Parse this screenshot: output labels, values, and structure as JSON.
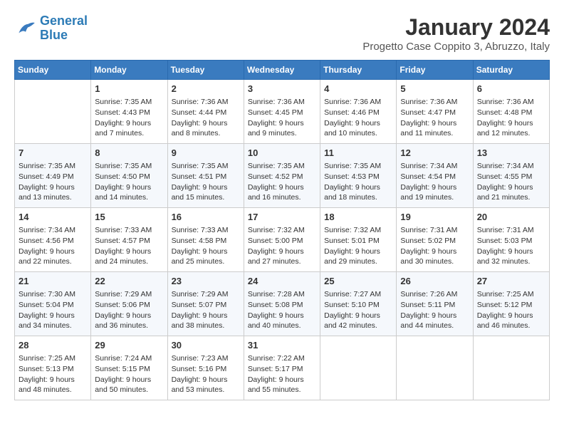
{
  "logo": {
    "line1": "General",
    "line2": "Blue"
  },
  "title": "January 2024",
  "subtitle": "Progetto Case Coppito 3, Abruzzo, Italy",
  "days_of_week": [
    "Sunday",
    "Monday",
    "Tuesday",
    "Wednesday",
    "Thursday",
    "Friday",
    "Saturday"
  ],
  "weeks": [
    [
      {
        "day": "",
        "sunrise": "",
        "sunset": "",
        "daylight": ""
      },
      {
        "day": "1",
        "sunrise": "Sunrise: 7:35 AM",
        "sunset": "Sunset: 4:43 PM",
        "daylight": "Daylight: 9 hours and 7 minutes."
      },
      {
        "day": "2",
        "sunrise": "Sunrise: 7:36 AM",
        "sunset": "Sunset: 4:44 PM",
        "daylight": "Daylight: 9 hours and 8 minutes."
      },
      {
        "day": "3",
        "sunrise": "Sunrise: 7:36 AM",
        "sunset": "Sunset: 4:45 PM",
        "daylight": "Daylight: 9 hours and 9 minutes."
      },
      {
        "day": "4",
        "sunrise": "Sunrise: 7:36 AM",
        "sunset": "Sunset: 4:46 PM",
        "daylight": "Daylight: 9 hours and 10 minutes."
      },
      {
        "day": "5",
        "sunrise": "Sunrise: 7:36 AM",
        "sunset": "Sunset: 4:47 PM",
        "daylight": "Daylight: 9 hours and 11 minutes."
      },
      {
        "day": "6",
        "sunrise": "Sunrise: 7:36 AM",
        "sunset": "Sunset: 4:48 PM",
        "daylight": "Daylight: 9 hours and 12 minutes."
      }
    ],
    [
      {
        "day": "7",
        "sunrise": "Sunrise: 7:35 AM",
        "sunset": "Sunset: 4:49 PM",
        "daylight": "Daylight: 9 hours and 13 minutes."
      },
      {
        "day": "8",
        "sunrise": "Sunrise: 7:35 AM",
        "sunset": "Sunset: 4:50 PM",
        "daylight": "Daylight: 9 hours and 14 minutes."
      },
      {
        "day": "9",
        "sunrise": "Sunrise: 7:35 AM",
        "sunset": "Sunset: 4:51 PM",
        "daylight": "Daylight: 9 hours and 15 minutes."
      },
      {
        "day": "10",
        "sunrise": "Sunrise: 7:35 AM",
        "sunset": "Sunset: 4:52 PM",
        "daylight": "Daylight: 9 hours and 16 minutes."
      },
      {
        "day": "11",
        "sunrise": "Sunrise: 7:35 AM",
        "sunset": "Sunset: 4:53 PM",
        "daylight": "Daylight: 9 hours and 18 minutes."
      },
      {
        "day": "12",
        "sunrise": "Sunrise: 7:34 AM",
        "sunset": "Sunset: 4:54 PM",
        "daylight": "Daylight: 9 hours and 19 minutes."
      },
      {
        "day": "13",
        "sunrise": "Sunrise: 7:34 AM",
        "sunset": "Sunset: 4:55 PM",
        "daylight": "Daylight: 9 hours and 21 minutes."
      }
    ],
    [
      {
        "day": "14",
        "sunrise": "Sunrise: 7:34 AM",
        "sunset": "Sunset: 4:56 PM",
        "daylight": "Daylight: 9 hours and 22 minutes."
      },
      {
        "day": "15",
        "sunrise": "Sunrise: 7:33 AM",
        "sunset": "Sunset: 4:57 PM",
        "daylight": "Daylight: 9 hours and 24 minutes."
      },
      {
        "day": "16",
        "sunrise": "Sunrise: 7:33 AM",
        "sunset": "Sunset: 4:58 PM",
        "daylight": "Daylight: 9 hours and 25 minutes."
      },
      {
        "day": "17",
        "sunrise": "Sunrise: 7:32 AM",
        "sunset": "Sunset: 5:00 PM",
        "daylight": "Daylight: 9 hours and 27 minutes."
      },
      {
        "day": "18",
        "sunrise": "Sunrise: 7:32 AM",
        "sunset": "Sunset: 5:01 PM",
        "daylight": "Daylight: 9 hours and 29 minutes."
      },
      {
        "day": "19",
        "sunrise": "Sunrise: 7:31 AM",
        "sunset": "Sunset: 5:02 PM",
        "daylight": "Daylight: 9 hours and 30 minutes."
      },
      {
        "day": "20",
        "sunrise": "Sunrise: 7:31 AM",
        "sunset": "Sunset: 5:03 PM",
        "daylight": "Daylight: 9 hours and 32 minutes."
      }
    ],
    [
      {
        "day": "21",
        "sunrise": "Sunrise: 7:30 AM",
        "sunset": "Sunset: 5:04 PM",
        "daylight": "Daylight: 9 hours and 34 minutes."
      },
      {
        "day": "22",
        "sunrise": "Sunrise: 7:29 AM",
        "sunset": "Sunset: 5:06 PM",
        "daylight": "Daylight: 9 hours and 36 minutes."
      },
      {
        "day": "23",
        "sunrise": "Sunrise: 7:29 AM",
        "sunset": "Sunset: 5:07 PM",
        "daylight": "Daylight: 9 hours and 38 minutes."
      },
      {
        "day": "24",
        "sunrise": "Sunrise: 7:28 AM",
        "sunset": "Sunset: 5:08 PM",
        "daylight": "Daylight: 9 hours and 40 minutes."
      },
      {
        "day": "25",
        "sunrise": "Sunrise: 7:27 AM",
        "sunset": "Sunset: 5:10 PM",
        "daylight": "Daylight: 9 hours and 42 minutes."
      },
      {
        "day": "26",
        "sunrise": "Sunrise: 7:26 AM",
        "sunset": "Sunset: 5:11 PM",
        "daylight": "Daylight: 9 hours and 44 minutes."
      },
      {
        "day": "27",
        "sunrise": "Sunrise: 7:25 AM",
        "sunset": "Sunset: 5:12 PM",
        "daylight": "Daylight: 9 hours and 46 minutes."
      }
    ],
    [
      {
        "day": "28",
        "sunrise": "Sunrise: 7:25 AM",
        "sunset": "Sunset: 5:13 PM",
        "daylight": "Daylight: 9 hours and 48 minutes."
      },
      {
        "day": "29",
        "sunrise": "Sunrise: 7:24 AM",
        "sunset": "Sunset: 5:15 PM",
        "daylight": "Daylight: 9 hours and 50 minutes."
      },
      {
        "day": "30",
        "sunrise": "Sunrise: 7:23 AM",
        "sunset": "Sunset: 5:16 PM",
        "daylight": "Daylight: 9 hours and 53 minutes."
      },
      {
        "day": "31",
        "sunrise": "Sunrise: 7:22 AM",
        "sunset": "Sunset: 5:17 PM",
        "daylight": "Daylight: 9 hours and 55 minutes."
      },
      {
        "day": "",
        "sunrise": "",
        "sunset": "",
        "daylight": ""
      },
      {
        "day": "",
        "sunrise": "",
        "sunset": "",
        "daylight": ""
      },
      {
        "day": "",
        "sunrise": "",
        "sunset": "",
        "daylight": ""
      }
    ]
  ]
}
